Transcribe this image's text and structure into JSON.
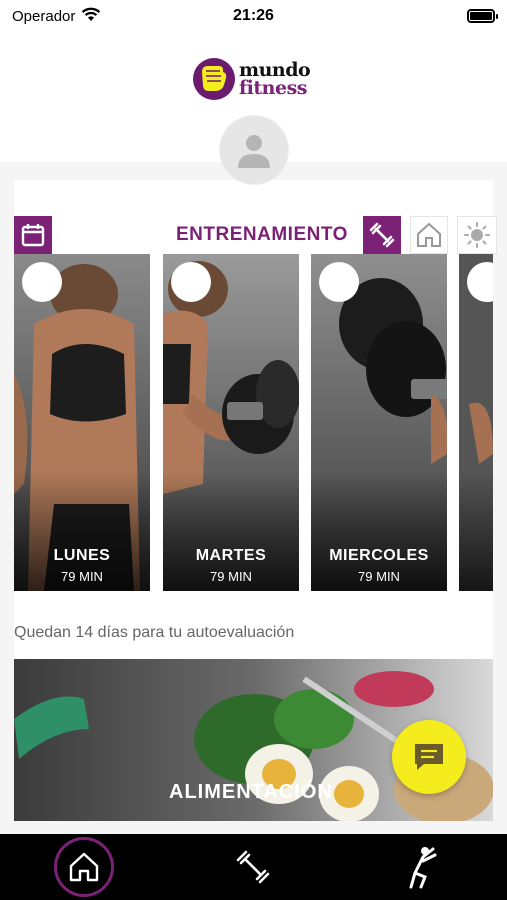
{
  "status_bar": {
    "carrier": "Operador",
    "time": "21:26"
  },
  "header": {
    "logo_line1": "mundo",
    "logo_line2": "fitness"
  },
  "section": {
    "title": "ENTRENAMIENTO",
    "calendar_icon": "calendar-icon",
    "categories": [
      {
        "icon": "dumbbell-icon",
        "active": true
      },
      {
        "icon": "house-icon",
        "active": false
      },
      {
        "icon": "sun-icon",
        "active": false
      }
    ]
  },
  "days": [
    {
      "name": "LUNES",
      "duration": "79 MIN"
    },
    {
      "name": "MARTES",
      "duration": "79 MIN"
    },
    {
      "name": "MIERCOLES",
      "duration": "79 MIN"
    },
    {
      "name": "",
      "duration": ""
    }
  ],
  "notice": "Quedan 14 días para tu autoevaluación",
  "nutrition": {
    "label": "ALIMENTACIÓN"
  },
  "tabs": [
    {
      "icon": "home-icon",
      "active": true
    },
    {
      "icon": "dumbbell-icon",
      "active": false
    },
    {
      "icon": "stretch-icon",
      "active": false
    }
  ],
  "colors": {
    "brand_purple": "#7b2176",
    "fab_yellow": "#f4ec1c",
    "tab_bar": "#000000"
  }
}
